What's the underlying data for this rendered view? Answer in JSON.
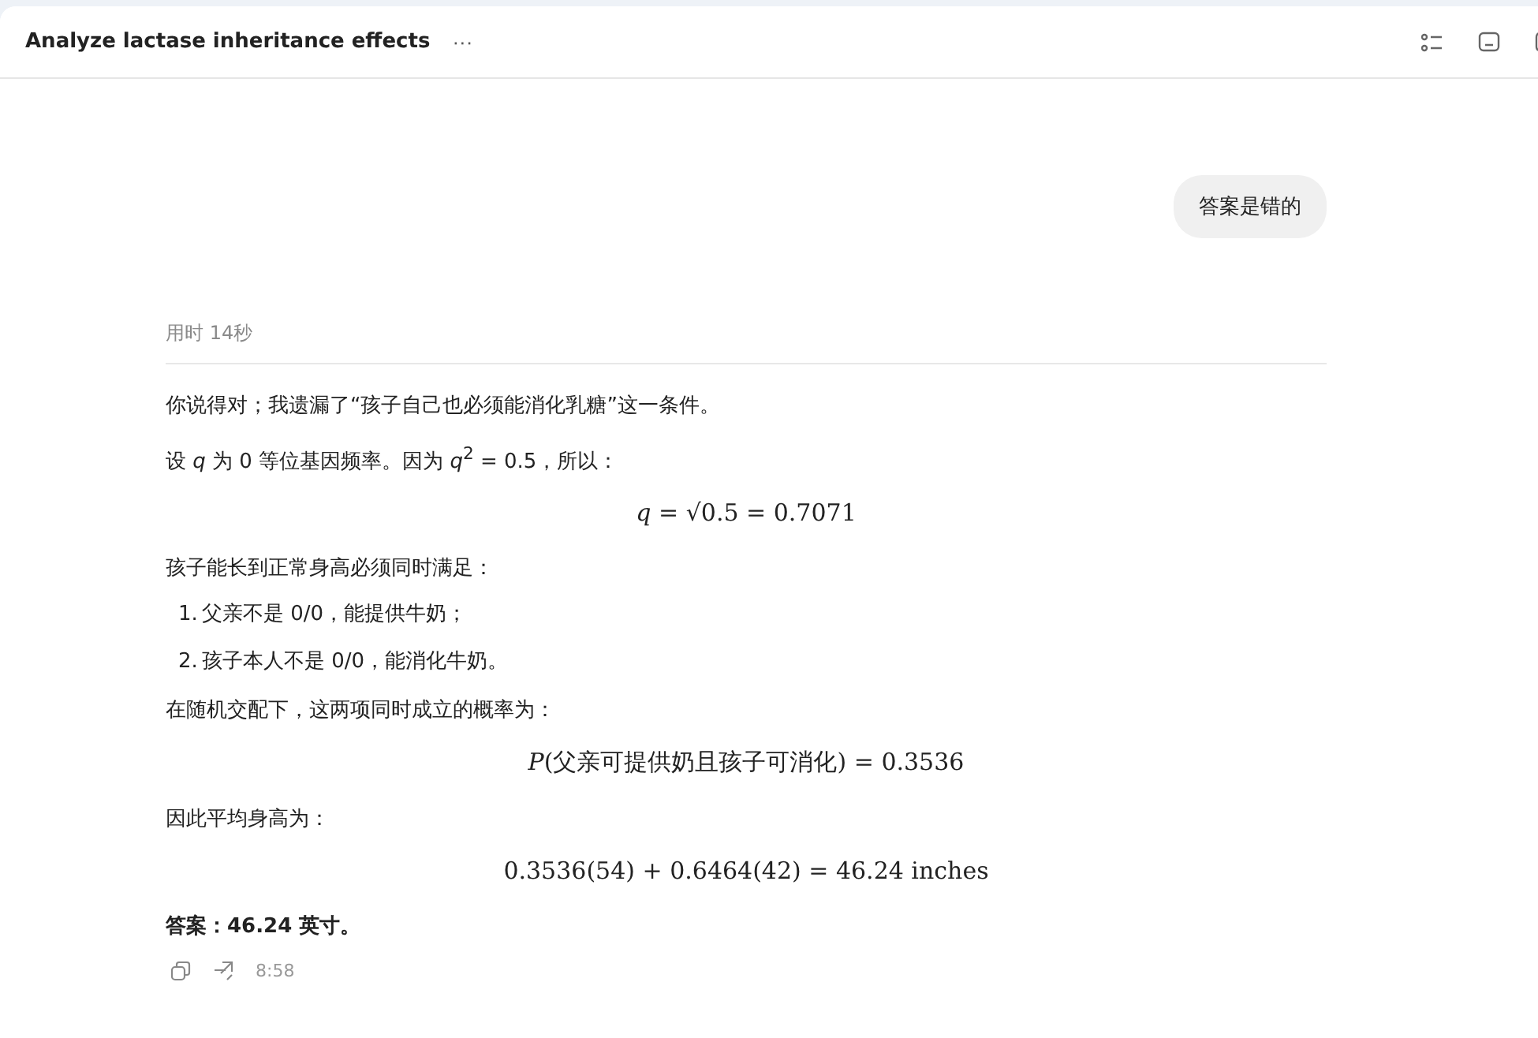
{
  "header": {
    "title": "Analyze lactase inheritance effects",
    "more": "···"
  },
  "user_message": "答案是错的",
  "thinking_time": "用时 14秒",
  "answer": [
    {
      "kind": "para",
      "text": "你说得对；我遗漏了“孩子自己也必须能消化乳糖”这一条件。"
    },
    {
      "kind": "para",
      "text": "设 *q* 为 0 等位基因频率。因为 *q*$^{2}$ = 0.5，所以："
    },
    {
      "kind": "equation",
      "text": "*q* = √0.5 = 0.7071"
    },
    {
      "kind": "para",
      "text": "孩子能长到正常身高必须同时满足："
    },
    {
      "kind": "list_item",
      "number": "1.",
      "text": "父亲不是 0/0，能提供牛奶；"
    },
    {
      "kind": "list_item",
      "number": "2.",
      "text": "孩子本人不是 0/0，能消化牛奶。"
    },
    {
      "kind": "para",
      "text": "在随机交配下，这两项同时成立的概率为："
    },
    {
      "kind": "equation",
      "text": "*P*(父亲可提供奶且孩子可消化) = 0.3536"
    },
    {
      "kind": "para",
      "text": "因此平均身高为："
    },
    {
      "kind": "equation",
      "text": "0.3536(54) + 0.6464(42) = 46.24 inches"
    },
    {
      "kind": "para",
      "text": "**答案：46.24 英寸。**"
    }
  ],
  "time": "8:58"
}
